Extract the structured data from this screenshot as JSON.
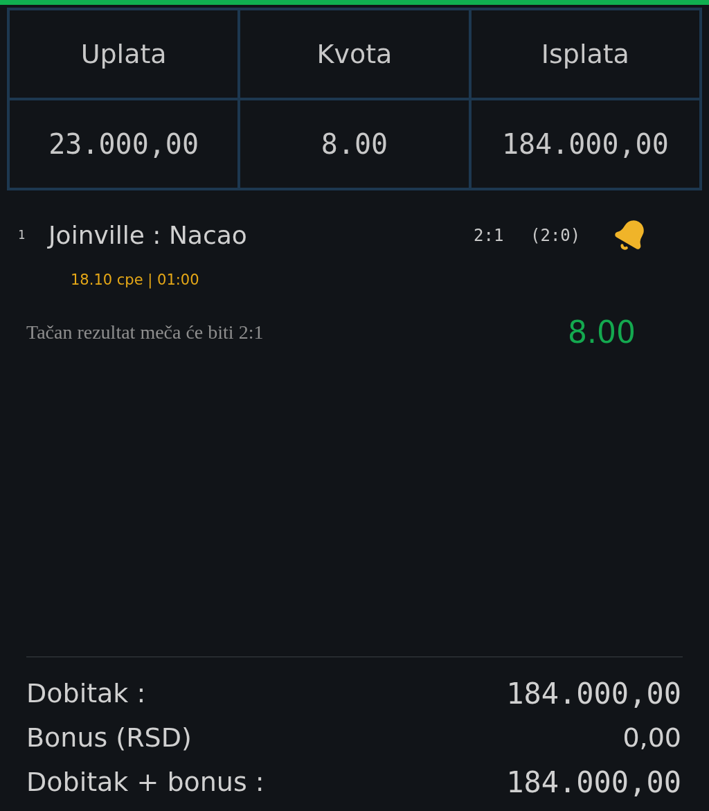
{
  "summary_table": {
    "columns": [
      "Uplata",
      "Kvota",
      "Isplata"
    ],
    "values": [
      "23.000,00",
      "8.00",
      "184.000,00"
    ]
  },
  "bets": [
    {
      "number": "1",
      "match": "Joinville : Nacao",
      "score": "2:1",
      "halftime": "(2:0)",
      "datetime": "18.10 сре | 01:00",
      "pick": "Tačan rezultat meča će biti 2:1",
      "odds": "8.00"
    }
  ],
  "totals": [
    {
      "label": "Dobitak :",
      "value": "184.000,00",
      "kind": "mono"
    },
    {
      "label": "Bonus (RSD)",
      "value": "0,00",
      "kind": "sans"
    },
    {
      "label": "Dobitak + bonus :",
      "value": "184.000,00",
      "kind": "mono"
    }
  ]
}
